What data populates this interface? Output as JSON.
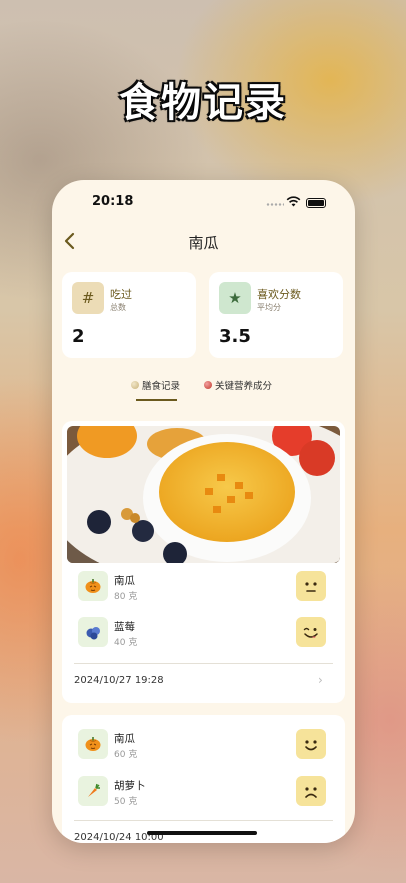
{
  "hero": {
    "title": "食物记录"
  },
  "status": {
    "time": "20:18"
  },
  "nav": {
    "back_icon": "chevron-left",
    "title": "南瓜"
  },
  "stats": [
    {
      "icon": "hash-icon",
      "icon_glyph": "#",
      "icon_bg": "#ecdcb6",
      "label": "吃过",
      "sub": "总数",
      "value": "2"
    },
    {
      "icon": "star-icon",
      "icon_glyph": "★",
      "icon_bg": "#cfe7cf",
      "label": "喜欢分数",
      "sub": "平均分",
      "value": "3.5"
    }
  ],
  "tabs": [
    {
      "label": "膳食记录",
      "active": true
    },
    {
      "label": "关键营养成分",
      "active": false
    }
  ],
  "records": [
    {
      "items": [
        {
          "name": "南瓜",
          "qty": "80 克",
          "icon": "pumpkin-icon",
          "face": "neutral-face-icon"
        },
        {
          "name": "蓝莓",
          "qty": "40 克",
          "icon": "blueberry-icon",
          "face": "yum-face-icon"
        }
      ],
      "date": "2024/10/27 19:28"
    },
    {
      "items": [
        {
          "name": "南瓜",
          "qty": "60 克",
          "icon": "pumpkin-icon",
          "face": "happy-face-icon"
        },
        {
          "name": "胡萝卜",
          "qty": "50 克",
          "icon": "carrot-icon",
          "face": "sad-face-icon"
        }
      ],
      "date": "2024/10/24 10:00"
    }
  ],
  "colors": {
    "accent": "#6b5a1e",
    "face_bg": "#f6e39a",
    "item_bg": "#e9f3df",
    "phone_bg": "#fdf6e9"
  }
}
